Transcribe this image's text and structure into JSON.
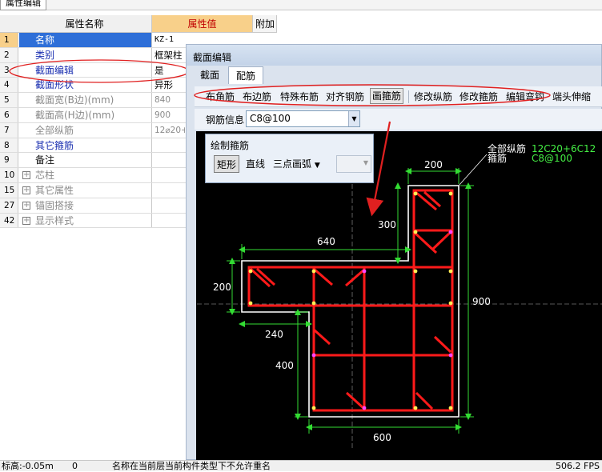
{
  "window": {
    "tab_label": "属性编辑"
  },
  "property_grid": {
    "headers": {
      "name": "属性名称",
      "value": "属性值",
      "extra": "附加"
    },
    "rows": [
      {
        "idx": "1",
        "name": "名称",
        "value": "KZ-1"
      },
      {
        "idx": "2",
        "name": "类别",
        "value": "框架柱"
      },
      {
        "idx": "3",
        "name": "截面编辑",
        "value": "是"
      },
      {
        "idx": "4",
        "name": "截面形状",
        "value": "异形"
      },
      {
        "idx": "5",
        "name": "截面宽(B边)(mm)",
        "value": "840"
      },
      {
        "idx": "6",
        "name": "截面高(H边)(mm)",
        "value": "900"
      },
      {
        "idx": "7",
        "name": "全部纵筋",
        "value": "12⌀20+"
      },
      {
        "idx": "8",
        "name": "其它箍筋",
        "value": ""
      },
      {
        "idx": "9",
        "name": "备注",
        "value": ""
      },
      {
        "idx": "10",
        "name": "芯柱",
        "value": ""
      },
      {
        "idx": "15",
        "name": "其它属性",
        "value": ""
      },
      {
        "idx": "27",
        "name": "锚固搭接",
        "value": ""
      },
      {
        "idx": "42",
        "name": "显示样式",
        "value": ""
      }
    ]
  },
  "section_editor": {
    "title": "截面编辑",
    "tabs": [
      "截面",
      "配筋"
    ],
    "toolbar": [
      "布角筋",
      "布边筋",
      "特殊布筋",
      "对齐钢筋",
      "画箍筋",
      "修改纵筋",
      "修改箍筋",
      "编辑弯钩",
      "端头伸缩"
    ],
    "rebar_info": {
      "label": "钢筋信息",
      "value": "C8@100"
    },
    "draw_panel": {
      "title": "绘制箍筋",
      "buttons": [
        "矩形",
        "直线",
        "三点画弧"
      ]
    },
    "canvas": {
      "legend_longitudinal_label": "全部纵筋",
      "legend_longitudinal_value": "12C20+6C12",
      "legend_stirrup_label": "箍筋",
      "legend_stirrup_value": "C8@100",
      "dimensions": {
        "top_width": "200",
        "left_width": "640",
        "inner_drop": "300",
        "left_height": "200",
        "total_height": "900",
        "notch_width": "240",
        "lower_height": "400",
        "bottom_width": "600"
      }
    }
  },
  "status_bar": {
    "elevation": "标高:-0.05m",
    "zero": "0",
    "message": "名称在当前层当前构件类型下不允许重名",
    "fps": "506.2 FPS"
  },
  "colors": {
    "rebar": "#ff1a1a",
    "dimension": "#33dd33",
    "outline": "#ffffff",
    "highlight_ellipse": "#e02020",
    "selected_row": "#2e6fd8",
    "header_value": "#f8d08a"
  }
}
